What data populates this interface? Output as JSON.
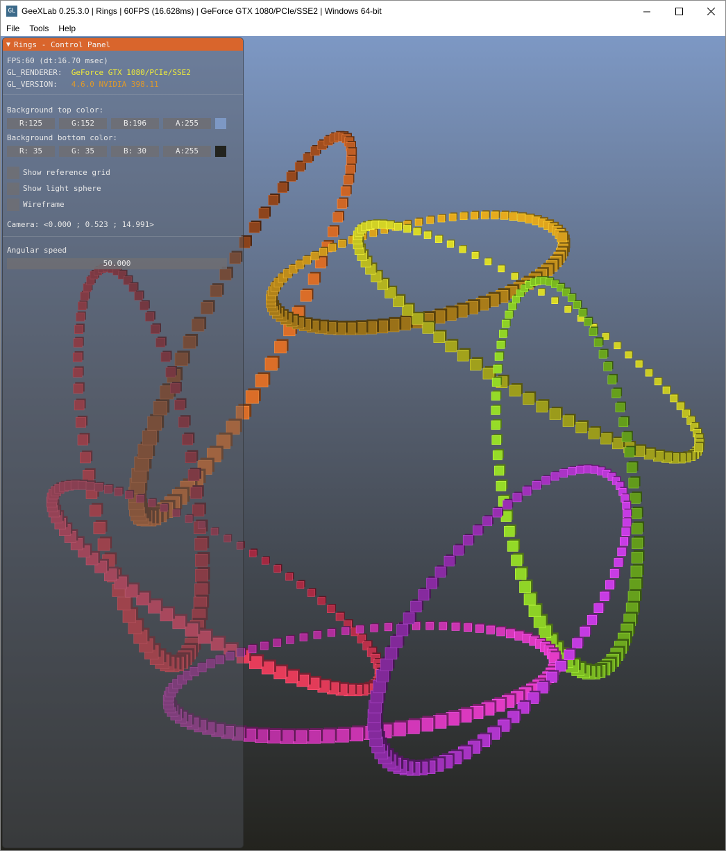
{
  "window": {
    "title": "GeeXLab 0.25.3.0 | Rings | 60FPS (16.628ms) | GeForce GTX 1080/PCIe/SSE2 | Windows 64-bit",
    "icon_text": "GL",
    "buttons": {
      "minimize": "–",
      "maximize": "☐",
      "close": "✕"
    }
  },
  "menu": {
    "items": [
      "File",
      "Tools",
      "Help"
    ]
  },
  "panel": {
    "title": "Rings - Control Panel",
    "fps_line": "FPS:60 (dt:16.70 msec)",
    "renderer_label": "GL_RENDERER:",
    "renderer_value": "GeForce GTX 1080/PCIe/SSE2",
    "version_label": "GL_VERSION:",
    "version_value": "4.6.0 NVIDIA 398.11",
    "bg_top_label": "Background top color:",
    "bg_top": {
      "r": "R:125",
      "g": "G:152",
      "b": "B:196",
      "a": "A:255",
      "swatch": "#7d98c4"
    },
    "bg_bottom_label": "Background bottom color:",
    "bg_bottom": {
      "r": "R: 35",
      "g": "G: 35",
      "b": "B: 30",
      "a": "A:255",
      "swatch": "#23231e"
    },
    "checkboxes": [
      "Show reference grid",
      "Show light sphere",
      "Wireframe"
    ],
    "camera_line": "Camera: <0.000 ; 0.523 ; 14.991>",
    "angular_speed_label": "Angular speed",
    "angular_speed_value": "50.000"
  },
  "colors": {
    "panel_header": "#d9652c",
    "bg_top": "#7d98c4",
    "bg_bottom": "#23231e"
  }
}
